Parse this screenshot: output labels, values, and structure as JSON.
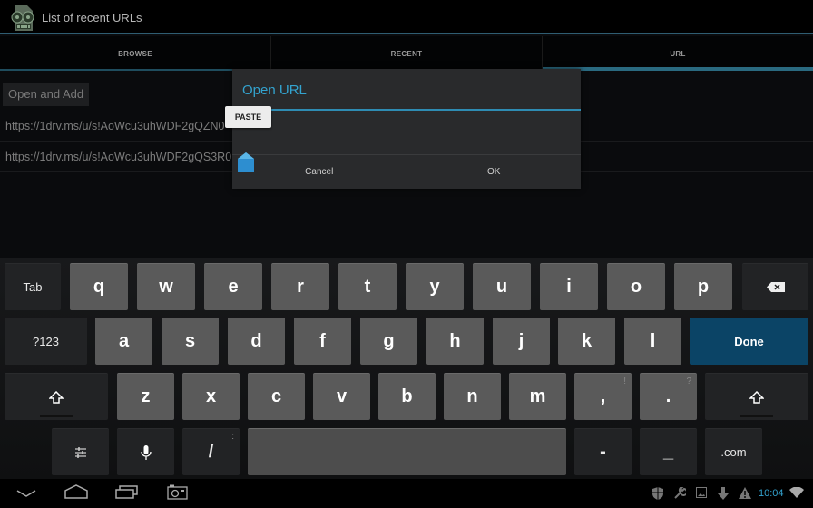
{
  "action_bar": {
    "title": "List of recent URLs",
    "icon": "film-reel-app-icon"
  },
  "tabs": [
    {
      "label": "BROWSE",
      "active": false
    },
    {
      "label": "RECENT",
      "active": false
    },
    {
      "label": "URL",
      "active": true
    }
  ],
  "content": {
    "open_add_label": "Open and Add",
    "urls": [
      "https://1drv.ms/u/s!AoWcu3uhWDF2gQZN0",
      "https://1drv.ms/u/s!AoWcu3uhWDF2gQS3R0"
    ]
  },
  "dialog": {
    "title": "Open URL",
    "input_value": "",
    "cancel_label": "Cancel",
    "ok_label": "OK",
    "paste_label": "PASTE"
  },
  "keyboard": {
    "row1": [
      "Tab",
      "q",
      "w",
      "e",
      "r",
      "t",
      "y",
      "u",
      "i",
      "o",
      "p",
      "backspace"
    ],
    "row2": [
      "?123",
      "a",
      "s",
      "d",
      "f",
      "g",
      "h",
      "j",
      "k",
      "l",
      "Done"
    ],
    "row3": [
      "shift",
      "z",
      "x",
      "c",
      "v",
      "b",
      "n",
      "m",
      ",",
      ".",
      "shift"
    ],
    "row3_hints": {
      ",": "!",
      ".": "?"
    },
    "row4": [
      "settings",
      "mic",
      "/",
      "space",
      "-",
      "_",
      ".com"
    ],
    "row4_hints": {
      "/": ":"
    },
    "accent_color": "#0b4466"
  },
  "navbar": {
    "buttons": [
      "back",
      "home",
      "recent-apps",
      "screenshot"
    ],
    "status_icons": [
      "shield",
      "wrench",
      "image",
      "download",
      "warning"
    ],
    "clock": "10:04",
    "wifi": "wifi"
  }
}
